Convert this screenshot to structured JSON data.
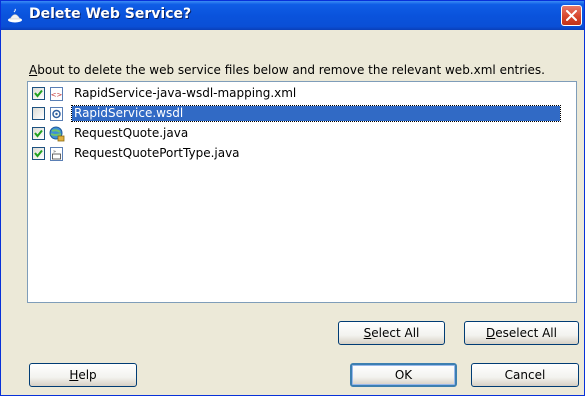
{
  "dialog": {
    "title": "Delete Web Service?",
    "description_prefix": "A",
    "description_rest": "bout to delete the web service files below and remove the relevant web.xml entries."
  },
  "files": [
    {
      "name": "RapidService-java-wsdl-mapping.xml",
      "checked": true,
      "icon": "xml-file-icon",
      "selected": false
    },
    {
      "name": "RapidService.wsdl",
      "checked": false,
      "icon": "wsdl-file-icon",
      "selected": true
    },
    {
      "name": "RequestQuote.java",
      "checked": true,
      "icon": "web-service-class-icon",
      "selected": false
    },
    {
      "name": "RequestQuotePortType.java",
      "checked": true,
      "icon": "java-interface-icon",
      "selected": false
    }
  ],
  "buttons": {
    "select_all": {
      "mnemonic": "S",
      "rest": "elect All"
    },
    "deselect_all": {
      "mnemonic": "D",
      "rest": "eselect All"
    },
    "help": {
      "mnemonic": "H",
      "rest": "elp"
    },
    "ok": "OK",
    "cancel": "Cancel"
  },
  "colors": {
    "titlebar": "#0a53dc",
    "selection": "#316ac5",
    "dialog_bg": "#ece9d8"
  }
}
